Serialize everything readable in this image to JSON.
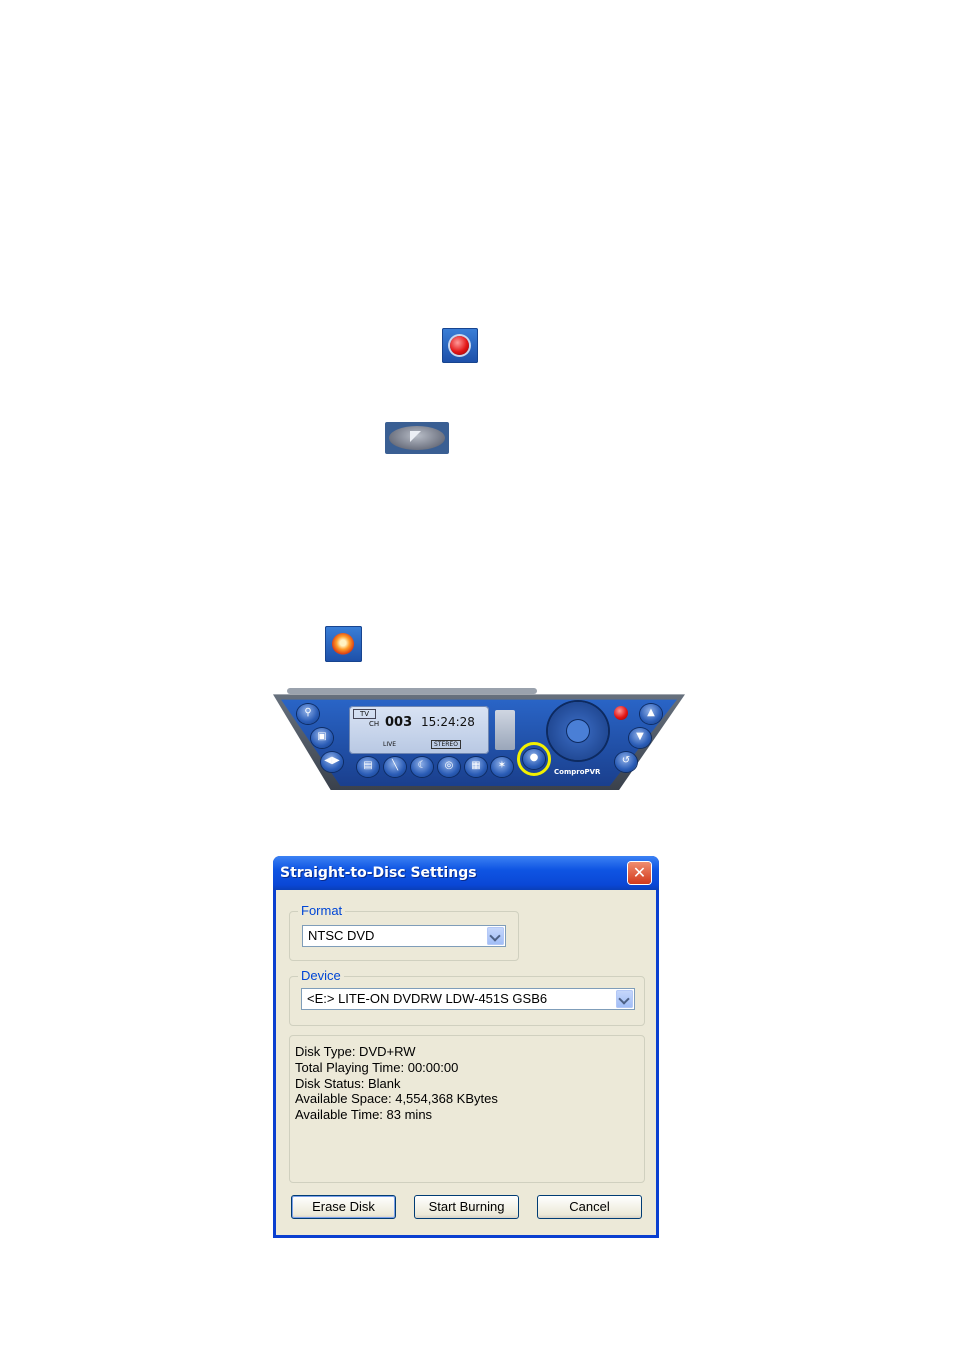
{
  "icons": {
    "record": "record-icon",
    "stop": "stop-icon",
    "straight_to_disc": "straight-to-disc-icon"
  },
  "player": {
    "window_controls": "≡ ? – ▫ ✕",
    "mode": "TV",
    "ch_label": "CH",
    "channel": "003",
    "clock": "15:24:28",
    "live": "LIVE",
    "audio": "STEREO",
    "brand": "ComproPVR",
    "highlight_color": "#f2f000"
  },
  "dialog": {
    "title": "Straight-to-Disc Settings",
    "close_symbol": "✕",
    "format": {
      "legend": "Format",
      "value": "NTSC DVD"
    },
    "device": {
      "legend": "Device",
      "value": "<E:>  LITE-ON DVDRW LDW-451S  GSB6"
    },
    "info": {
      "disk_type": "Disk Type: DVD+RW",
      "total_playing_time": "Total Playing Time: 00:00:00",
      "disk_status": "Disk Status: Blank",
      "available_space": "Available Space: 4,554,368 KBytes",
      "available_time": "Available Time: 83 mins"
    },
    "buttons": {
      "erase": "Erase Disk",
      "start": "Start Burning",
      "cancel": "Cancel"
    }
  }
}
